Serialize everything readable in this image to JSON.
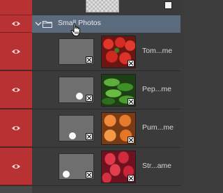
{
  "group": {
    "name": "Small Photos",
    "expanded": true
  },
  "layers": [
    {
      "name": "Tom...me",
      "photo": "tomato",
      "mask_dot": false
    },
    {
      "name": "Pep...me",
      "photo": "pepper",
      "mask_dot": true
    },
    {
      "name": "Pum...me",
      "photo": "pumpkin",
      "mask_dot": true
    },
    {
      "name": "Str...ame",
      "photo": "straw",
      "mask_dot": true
    }
  ],
  "colors": {
    "visibility_active": "#b83234",
    "group_selected": "#5b6a7d",
    "panel_bg": "#3b3b3b"
  },
  "icons": {
    "visibility": "eye-icon",
    "group": "folder-icon",
    "expand": "chevron-down-icon",
    "link": "link-badge-icon",
    "cursor": "hand-pointer-icon"
  }
}
